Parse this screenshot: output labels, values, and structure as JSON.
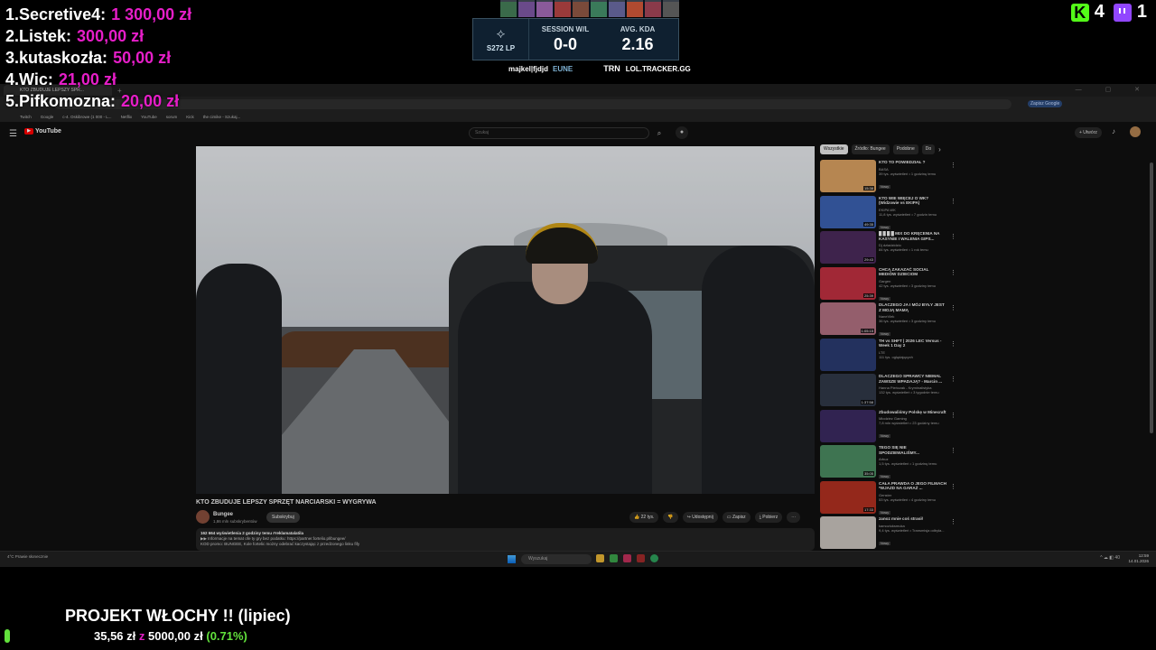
{
  "leaderboard": [
    {
      "rank": "1.",
      "name": "Secretive4:",
      "amount": "1 300,00 zł"
    },
    {
      "rank": "2.",
      "name": "Listek:",
      "amount": "300,00 zł"
    },
    {
      "rank": "3.",
      "name": "kutaskozła:",
      "amount": "50,00 zł"
    },
    {
      "rank": "4.",
      "name": "Wic:",
      "amount": "21,00 zł"
    },
    {
      "rank": "5.",
      "name": "Pifkomozna:",
      "amount": "20,00 zł"
    }
  ],
  "tracker": {
    "rank_lp": "S272 LP",
    "session_label": "SESSION W/L",
    "session_value": "0-0",
    "kda_label": "AVG. KDA",
    "kda_value": "2.16",
    "summoner": "majkel|fjdjd",
    "region": "EUNE",
    "logo": "TRN",
    "url": "LOL.TRACKER.GG"
  },
  "viewers": {
    "kick": "4",
    "twitch": "1"
  },
  "browser": {
    "tab_title": "KTO ZBUDUJE LEPSZY SPR...",
    "sync_label": "Zapisz Google",
    "bookmarks": [
      "Twitch",
      "Google",
      "c-4. Oskibrowe (1 000 - L...",
      "Netflix",
      "YouTube",
      "sorum",
      "Kick",
      "the cimike - Szukaj..."
    ]
  },
  "youtube": {
    "logo": "YouTube",
    "search_placeholder": "Szukaj",
    "create_label": "+ Utwórz",
    "video_title": "KTO ZBUDUJE LEPSZY SPRZĘT NARCIARSKI = WYGRYWA",
    "channel_name": "Bungee",
    "channel_subs": "1,86 mln subskrybentów",
    "subscribe_label": "Subskrybuj",
    "actions": {
      "likes": "22 tys.",
      "share": "Udostępnij",
      "save": "Zapisz",
      "download": "Pobierz"
    },
    "description_meta": "162 664 wyświetlenia  2 godziny temu  #reklamatalatila",
    "description_line1": "▶▶ Informacje na temat ofe ty gry bez podatku: https://partner.fortelio.pl/bungee/",
    "description_line2": "KOD promo: BUNGEE, Kole fortelic możny odebrać kaczystając z przedzonego linku fify",
    "chips": [
      "Wszystkie",
      "Źródło: Bungee",
      "Podobne",
      "Do"
    ],
    "recommendations": [
      {
        "title": "KTO TO POWIEDZIAŁ ?",
        "channel": "BASA",
        "meta": "39 tys. wyświetleń • 1 godzinę temu",
        "badge": "Nowy",
        "duration": "15:38",
        "color": "#d9a060"
      },
      {
        "title": "KTO WIE WIĘCEJ O WK? (Widzowie vs EKIPA)",
        "channel": "EKIPA WK",
        "meta": "11,8 tys. wyświetleń • 7 godzin temu",
        "badge": "Nowy",
        "duration": "49:35",
        "color": "#3a60b0"
      },
      {
        "title": "█ █ █ █ MIX DO KRĘCENIA NA KASYNIE I WALENIA GIPS...",
        "channel": "Dj dziadzidzio",
        "meta": "84 tys. wyświetleń • 1 rok temu",
        "badge": "",
        "duration": "29:43",
        "color": "#4a2a5a"
      },
      {
        "title": "CHCĄ ZAKAZAĆ SOCIAL MEDIÓW DZIECIOM",
        "channel": "Gargen",
        "meta": "42 tys. wyświetleń • 3 godziny temu",
        "badge": "Nowy",
        "duration": "25:39",
        "color": "#c03040"
      },
      {
        "title": "DLACZEGO JA I MÓJ BYŁY JEST Z MOJĄ MAMĄ",
        "channel": "NaneVlek",
        "meta": "36 tys. wyświetleń • 3 godziny temu",
        "badge": "Nowy",
        "duration": "1:05:15",
        "color": "#b07080"
      },
      {
        "title": "TH vs SHFT | 2026 LEC Versus - Week 1 Day 2",
        "channel": "LTE",
        "meta": "111 tys. oglądających",
        "badge": "",
        "duration": "",
        "color": "#2a3a70"
      },
      {
        "title": "DLACZEGO SPRAWCY NIEMAL ZAWSZE WPADAJĄ? - Marcin ...",
        "channel": "Hanna Pieńczak - Kryminalistyka",
        "meta": "132 tys. wyświetleń • 3 tygodnie temu",
        "badge": "",
        "duration": "1:37:58",
        "color": "#303848"
      },
      {
        "title": "Zbudowaliśmy Polskę w Minecraft",
        "channel": "Młodziez Gaming",
        "meta": "7,8 mln wyświetleń • 23 godziny temu",
        "badge": "Nowy",
        "duration": "",
        "color": "#3a2a60"
      },
      {
        "title": "TEGO SIĘ NIE SPODZIEWALIŚMY... ",
        "channel": "Arbuz",
        "meta": "1,5 tys. wyświetleń • 1 godzinę temu",
        "badge": "Nowy",
        "duration": "35:05",
        "color": "#4a8a60"
      },
      {
        "title": "CAŁA PRAWDA O JEGO FILMACH *WJAZD NA GARAŻ ...",
        "channel": "Genster",
        "meta": "53 tys. wyświetleń • 4 godziny temu",
        "badge": "Nowy",
        "duration": "17:33",
        "color": "#b03020"
      },
      {
        "title": "zanoz mnie coś strasił",
        "channel": "kamoziuksmuka",
        "meta": "9,4 tys. wyświetleń • Transmisja odbyła...",
        "badge": "Nowy",
        "duration": "",
        "color": "#c8c2bc"
      }
    ]
  },
  "taskbar": {
    "weather": "4°C Prawie słonecznie",
    "search_placeholder": "Wyszukaj",
    "tray": "^  ☁  ◧ 40",
    "clock_time": "12:59",
    "clock_date": "14.01.2026"
  },
  "goal": {
    "title": "PROJEKT WŁOCHY !! (lipiec)",
    "current": "35,56 zł",
    "separator": "z",
    "total": "5000,00 zł",
    "percent": "(0.71%)",
    "progress_fraction": 0.0071
  }
}
